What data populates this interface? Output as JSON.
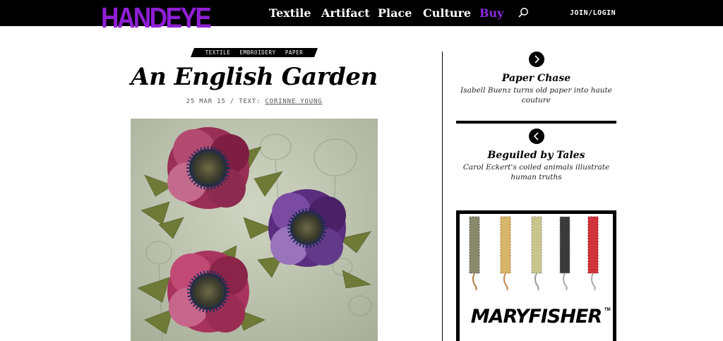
{
  "header": {
    "logo": "HANDEYE",
    "nav": [
      "Textile",
      "Artifact",
      "Place",
      "Culture",
      "Buy"
    ],
    "join_label": "JOIN/LOGIN"
  },
  "article": {
    "tags": [
      "TEXTILE",
      "EMBROIDERY",
      "PAPER"
    ],
    "title": "An English Garden",
    "date": "25 MAR 15",
    "text_prefix": "/ TEXT:",
    "author": "CORINNE YOUNG"
  },
  "sidebar": {
    "next": {
      "title": "Paper Chase",
      "description": "Isabell Buenz turns old paper into haute couture"
    },
    "prev": {
      "title": "Beguiled by Tales",
      "description": "Carol Eckert's coiled animals illustrate human truths"
    },
    "ad": {
      "wordmark": "MARYFISHER",
      "tm": "TM"
    }
  },
  "colors": {
    "brand": "#8f1fd4",
    "buy": "#8a2be2",
    "bar": "#000000"
  },
  "icons": [
    "search-icon",
    "chevron-right-icon",
    "chevron-left-icon"
  ]
}
